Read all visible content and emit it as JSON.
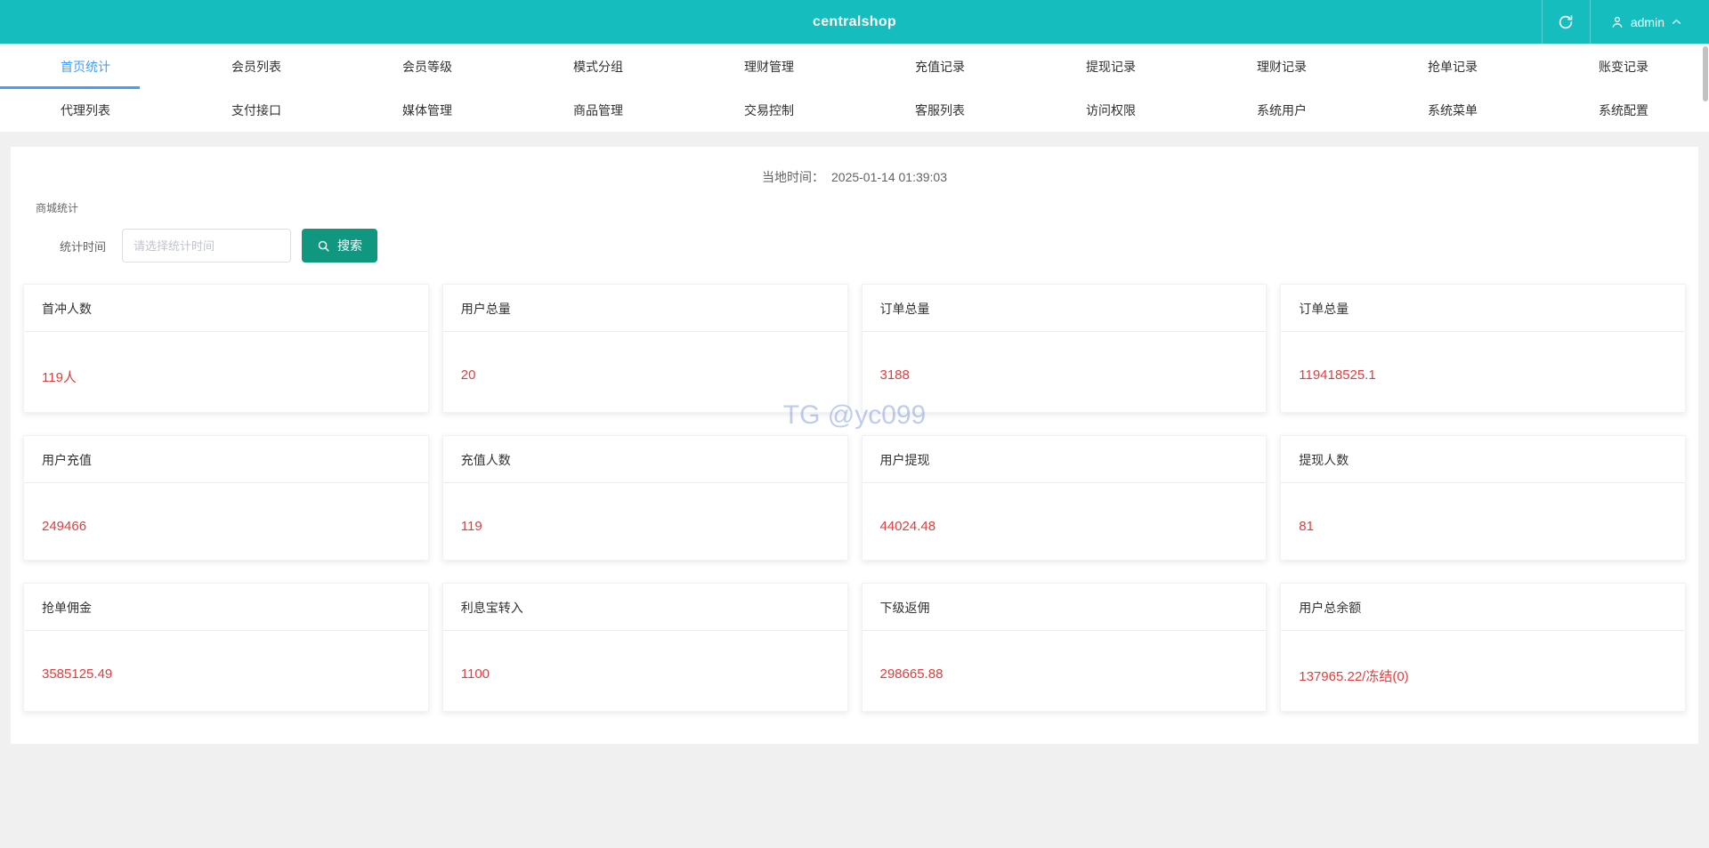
{
  "header": {
    "title": "centralshop",
    "user": "admin"
  },
  "nav": {
    "active": "首页统计",
    "row1": [
      "首页统计",
      "会员列表",
      "会员等级",
      "模式分组",
      "理财管理",
      "充值记录",
      "提现记录",
      "理财记录",
      "抢单记录",
      "账变记录"
    ],
    "row2": [
      "代理列表",
      "支付接口",
      "媒体管理",
      "商品管理",
      "交易控制",
      "客服列表",
      "访问权限",
      "系统用户",
      "系统菜单",
      "系统配置"
    ]
  },
  "main": {
    "local_time_label": "当地时间：",
    "local_time_value": "2025-01-14 01:39:03",
    "section_title": "商城统计",
    "filter": {
      "label": "统计时间",
      "placeholder": "请选择统计时间",
      "search_label": "搜索"
    },
    "cards": [
      {
        "title": "首冲人数",
        "value": "119人"
      },
      {
        "title": "用户总量",
        "value": "20"
      },
      {
        "title": "订单总量",
        "value": "3188"
      },
      {
        "title": "订单总量",
        "value": "119418525.1"
      },
      {
        "title": "用户充值",
        "value": "249466"
      },
      {
        "title": "充值人数",
        "value": "119"
      },
      {
        "title": "用户提现",
        "value": "44024.48"
      },
      {
        "title": "提现人数",
        "value": "81"
      },
      {
        "title": "抢单佣金",
        "value": "3585125.49"
      },
      {
        "title": "利息宝转入",
        "value": "1100"
      },
      {
        "title": "下级返佣",
        "value": "298665.88"
      },
      {
        "title": "用户总余额",
        "value": "137965.22/冻结(0)"
      }
    ],
    "watermark": "TG @yc099"
  },
  "icons": {
    "refresh": "refresh-icon",
    "user": "user-icon",
    "chevron_up": "chevron-up-icon",
    "search": "search-icon"
  },
  "colors": {
    "header_bg": "#16bdbe",
    "active_tab": "#409eff",
    "card_value": "#e03e3e",
    "search_button": "#0f9780",
    "page_bg": "#f0f0f0"
  }
}
